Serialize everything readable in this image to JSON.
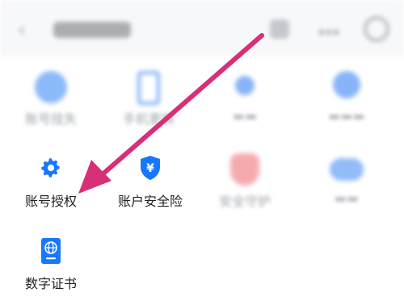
{
  "header": {
    "back_icon": "chevron-left-icon",
    "title_blurred": true
  },
  "items": [
    {
      "label": "账号挂失",
      "icon": "account-lost-icon",
      "faded": true
    },
    {
      "label": "手机更换",
      "icon": "phone-icon",
      "faded": true
    },
    {
      "label": "",
      "icon": "location-icon",
      "faded": true
    },
    {
      "label": "",
      "icon": "blue-circle-icon",
      "faded": true
    },
    {
      "label": "账号授权",
      "icon": "gear-icon",
      "faded": false
    },
    {
      "label": "账户安全险",
      "icon": "shield-yen-icon",
      "faded": false
    },
    {
      "label": "安全守护",
      "icon": "red-shield-icon",
      "faded": true
    },
    {
      "label": "",
      "icon": "blue-pill-icon",
      "faded": true
    },
    {
      "label": "数字证书",
      "icon": "passport-globe-icon",
      "faded": false
    }
  ],
  "colors": {
    "accent_blue": "#1677ff",
    "arrow": "#d72f78"
  }
}
